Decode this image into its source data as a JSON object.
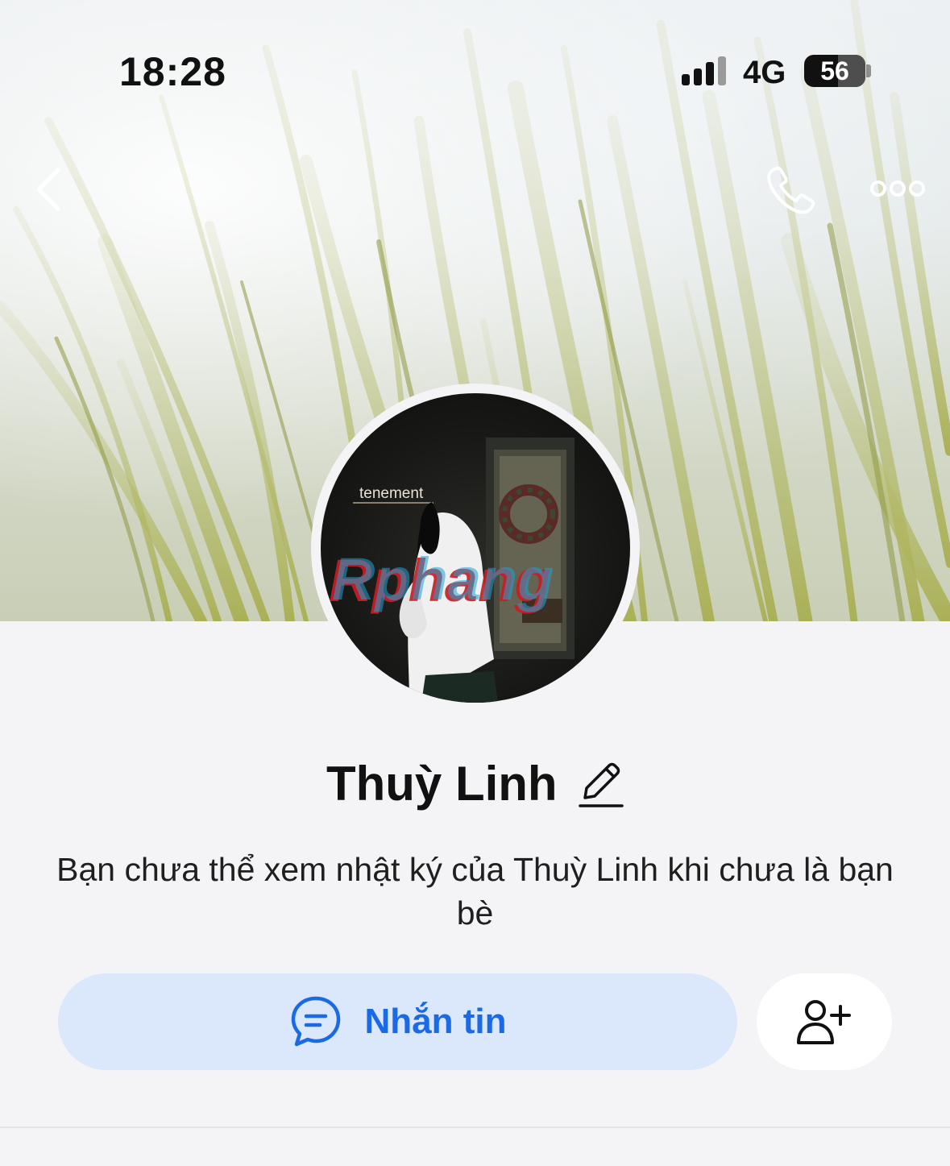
{
  "status_bar": {
    "time": "18:28",
    "network": "4G",
    "battery_level": "56"
  },
  "header": {
    "back_icon": "chevron-left-icon",
    "call_icon": "phone-icon",
    "more_icon": "more-dots-icon"
  },
  "avatar": {
    "sign_text": "tenement",
    "watermark_text": "Rphang"
  },
  "profile": {
    "name": "Thuỳ Linh",
    "edit_icon": "pencil-icon",
    "privacy_note": "Bạn chưa thể xem nhật ký của Thuỳ Linh khi chưa là bạn bè"
  },
  "actions": {
    "message_label": "Nhắn tin",
    "message_icon": "chat-bubble-icon",
    "add_friend_icon": "add-friend-icon"
  },
  "colors": {
    "accent": "#1a6ae6",
    "message_button_bg": "#dbe7fb",
    "page_bg": "#f4f4f6"
  }
}
